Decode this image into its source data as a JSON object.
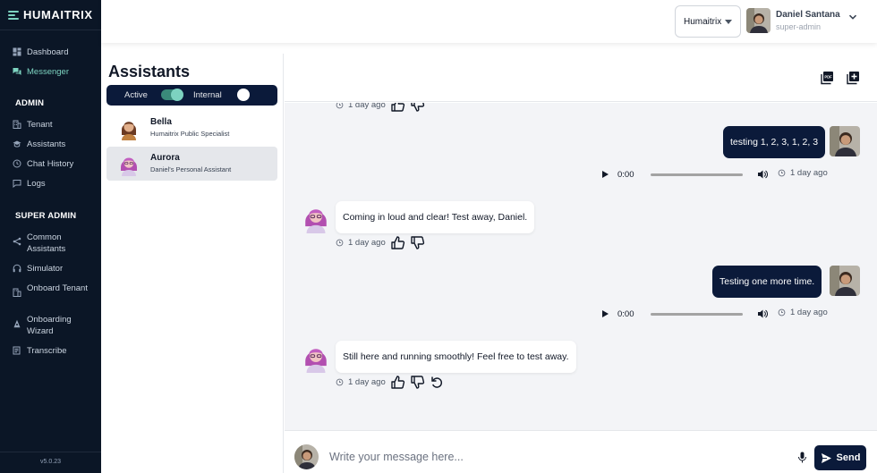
{
  "app": {
    "logo_text": "HUMAITRIX",
    "version": "v5.0.23"
  },
  "sidebar": {
    "main_items": [
      {
        "label": "Dashboard",
        "icon": "dashboard-icon",
        "active": false
      },
      {
        "label": "Messenger",
        "icon": "messenger-icon",
        "active": true
      }
    ],
    "admin_header": "ADMIN",
    "admin_items": [
      {
        "label": "Tenant",
        "icon": "building-icon"
      },
      {
        "label": "Assistants",
        "icon": "graduation-cap-icon"
      },
      {
        "label": "Chat History",
        "icon": "history-icon"
      },
      {
        "label": "Logs",
        "icon": "message-square-icon"
      }
    ],
    "super_admin_header": "SUPER ADMIN",
    "super_admin_items": [
      {
        "label": "Common Assistants",
        "icon": "share-icon"
      },
      {
        "label": "Simulator",
        "icon": "headphones-icon"
      },
      {
        "label": "Onboard Tenant",
        "icon": "building-plus-icon"
      },
      {
        "label": "Onboarding Wizard",
        "icon": "wizard-icon"
      },
      {
        "label": "Transcribe",
        "icon": "transcribe-icon"
      }
    ]
  },
  "topbar": {
    "tenant_selected": "Humaitrix",
    "user_name": "Daniel Santana",
    "user_role": "super-admin"
  },
  "assistants": {
    "title": "Assistants",
    "toggle_active_label": "Active",
    "toggle_internal_label": "Internal",
    "items": [
      {
        "name": "Bella",
        "description": "Humaitrix Public Specialist",
        "selected": false
      },
      {
        "name": "Aurora",
        "description": "Daniel's Personal Assistant",
        "selected": true
      }
    ]
  },
  "chat": {
    "header_buttons": [
      "pdf-export-icon",
      "new-chat-icon"
    ],
    "messages": [
      {
        "from": "assistant",
        "text": "",
        "time": "1 day ago",
        "partial": true
      },
      {
        "from": "user",
        "text": "testing 1, 2, 3, 1, 2, 3",
        "audio_time": "0:00",
        "time": "1 day ago"
      },
      {
        "from": "assistant",
        "text": "Coming in loud and clear! Test away, Daniel.",
        "time": "1 day ago"
      },
      {
        "from": "user",
        "text": "Testing one more time.",
        "audio_time": "0:00",
        "time": "1 day ago"
      },
      {
        "from": "assistant",
        "text": "Still here and running smoothly! Feel free to test away.",
        "time": "1 day ago"
      }
    ]
  },
  "composer": {
    "placeholder": "Write your message here...",
    "send_label": "Send"
  },
  "colors": {
    "navy": "#0b1a3a",
    "sidebar": "#0b1626",
    "accent": "#7dd3c0",
    "chat_bg": "#f3f4f7"
  }
}
